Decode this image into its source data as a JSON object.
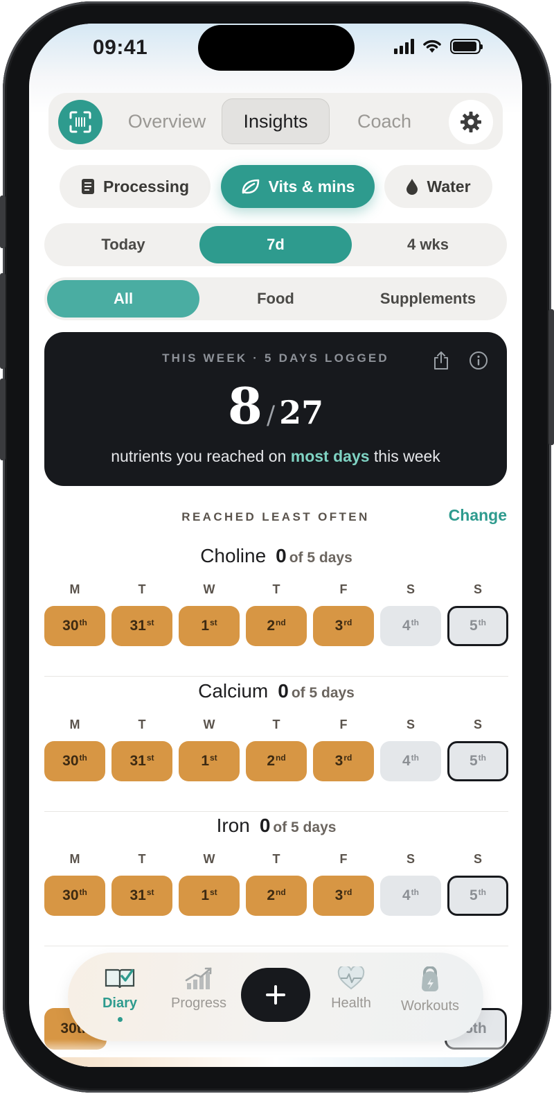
{
  "status_bar": {
    "time": "09:41"
  },
  "top_nav": {
    "tabs": [
      {
        "label": "Overview",
        "active": false
      },
      {
        "label": "Insights",
        "active": true
      },
      {
        "label": "Coach",
        "active": false
      }
    ]
  },
  "insight_pills": [
    {
      "label": "Processing",
      "icon": "book-icon",
      "active": false
    },
    {
      "label": "Vits & mins",
      "icon": "leaf-icon",
      "active": true
    },
    {
      "label": "Water",
      "icon": "droplet-icon",
      "active": false
    }
  ],
  "range_segment": {
    "options": [
      "Today",
      "7d",
      "4 wks"
    ],
    "selected": "7d"
  },
  "source_segment": {
    "options": [
      "All",
      "Food",
      "Supplements"
    ],
    "selected": "All"
  },
  "summary": {
    "caption": "THIS WEEK · 5 DAYS LOGGED",
    "reached": "8",
    "total": "27",
    "sub_before": "nutrients you reached on ",
    "sub_highlight": "most days",
    "sub_after": " this week"
  },
  "section": {
    "title": "REACHED LEAST OFTEN",
    "change_label": "Change"
  },
  "week_days": [
    {
      "letter": "M",
      "day": "30",
      "suffix": "th",
      "state": "miss"
    },
    {
      "letter": "T",
      "day": "31",
      "suffix": "st",
      "state": "miss"
    },
    {
      "letter": "W",
      "day": "1",
      "suffix": "st",
      "state": "miss"
    },
    {
      "letter": "T",
      "day": "2",
      "suffix": "nd",
      "state": "miss"
    },
    {
      "letter": "F",
      "day": "3",
      "suffix": "rd",
      "state": "miss"
    },
    {
      "letter": "S",
      "day": "4",
      "suffix": "th",
      "state": "future"
    },
    {
      "letter": "S",
      "day": "5",
      "suffix": "th",
      "state": "today"
    }
  ],
  "nutrients": [
    {
      "name": "Choline",
      "count": "0",
      "of_text": "of 5 days"
    },
    {
      "name": "Calcium",
      "count": "0",
      "of_text": "of 5 days"
    },
    {
      "name": "Iron",
      "count": "0",
      "of_text": "of 5 days"
    }
  ],
  "tab_bar": {
    "tabs": [
      {
        "label": "Diary",
        "icon": "diary-book-icon",
        "active": true
      },
      {
        "label": "Progress",
        "icon": "progress-chart-icon",
        "active": false
      },
      {
        "label": "Health",
        "icon": "heart-icon",
        "active": false
      },
      {
        "label": "Workouts",
        "icon": "kettlebell-icon",
        "active": false
      }
    ],
    "add_icon": "plus-icon"
  },
  "peek_row": {
    "first": "30th",
    "last": "5th"
  },
  "colors": {
    "accent": "#2e9b8e",
    "miss": "#d79644",
    "card": "#17191d"
  }
}
